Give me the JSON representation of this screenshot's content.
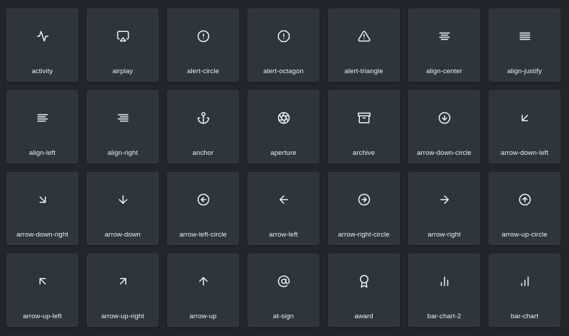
{
  "icons": [
    {
      "name": "activity",
      "label": "activity"
    },
    {
      "name": "airplay",
      "label": "airplay"
    },
    {
      "name": "alert-circle",
      "label": "alert-circle"
    },
    {
      "name": "alert-octagon",
      "label": "alert-octagon"
    },
    {
      "name": "alert-triangle",
      "label": "alert-triangle"
    },
    {
      "name": "align-center",
      "label": "align-center"
    },
    {
      "name": "align-justify",
      "label": "align-justify"
    },
    {
      "name": "align-left",
      "label": "align-left"
    },
    {
      "name": "align-right",
      "label": "align-right"
    },
    {
      "name": "anchor",
      "label": "anchor"
    },
    {
      "name": "aperture",
      "label": "aperture"
    },
    {
      "name": "archive",
      "label": "archive"
    },
    {
      "name": "arrow-down-circle",
      "label": "arrow-down-circle"
    },
    {
      "name": "arrow-down-left",
      "label": "arrow-down-left"
    },
    {
      "name": "arrow-down-right",
      "label": "arrow-down-right"
    },
    {
      "name": "arrow-down",
      "label": "arrow-down"
    },
    {
      "name": "arrow-left-circle",
      "label": "arrow-left-circle"
    },
    {
      "name": "arrow-left",
      "label": "arrow-left"
    },
    {
      "name": "arrow-right-circle",
      "label": "arrow-right-circle"
    },
    {
      "name": "arrow-right",
      "label": "arrow-right"
    },
    {
      "name": "arrow-up-circle",
      "label": "arrow-up-circle"
    },
    {
      "name": "arrow-up-left",
      "label": "arrow-up-left"
    },
    {
      "name": "arrow-up-right",
      "label": "arrow-up-right"
    },
    {
      "name": "arrow-up",
      "label": "arrow-up"
    },
    {
      "name": "at-sign",
      "label": "at-sign"
    },
    {
      "name": "award",
      "label": "award"
    },
    {
      "name": "bar-chart-2",
      "label": "bar-chart-2"
    },
    {
      "name": "bar-chart",
      "label": "bar-chart"
    }
  ],
  "colors": {
    "background": "#22262b",
    "card": "#2f353c",
    "icon": "#f1f3f5",
    "text": "#eef0f2"
  }
}
